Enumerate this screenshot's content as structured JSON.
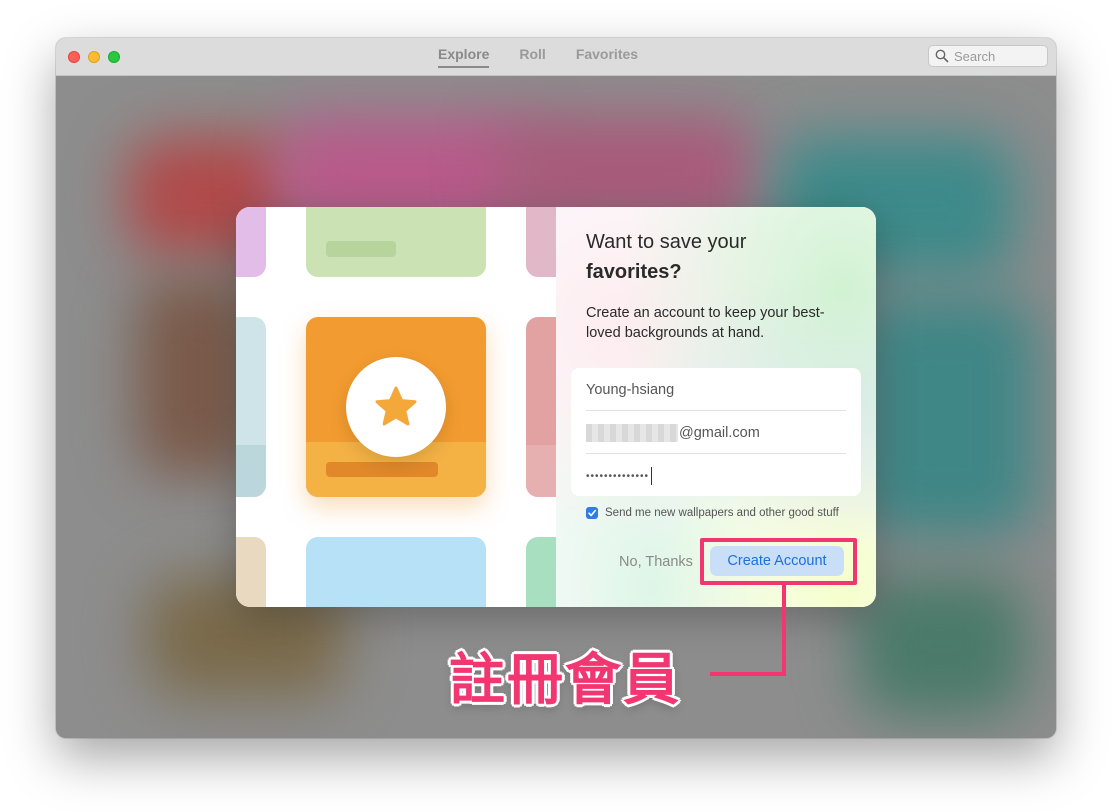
{
  "window": {
    "tabs": [
      {
        "label": "Explore",
        "active": true
      },
      {
        "label": "Roll",
        "active": false
      },
      {
        "label": "Favorites",
        "active": false
      }
    ],
    "search": {
      "placeholder": "Search",
      "icon": "search-icon"
    }
  },
  "dialog": {
    "title_line1": "Want to save your",
    "title_line2": "favorites?",
    "description": "Create an account to keep your best-loved backgrounds at hand.",
    "form": {
      "name_value": "Young-hsiang",
      "email_suffix": "@gmail.com",
      "password_dots": "••••••••••••••"
    },
    "checkbox": {
      "checked": true,
      "label": "Send me new wallpapers and other good stuff"
    },
    "no_thanks_label": "No, Thanks",
    "create_account_label": "Create Account",
    "accent_color": "#1d6fde",
    "featured_icon": "star-icon"
  },
  "annotation": {
    "text": "註冊會員",
    "color": "#f23672"
  }
}
